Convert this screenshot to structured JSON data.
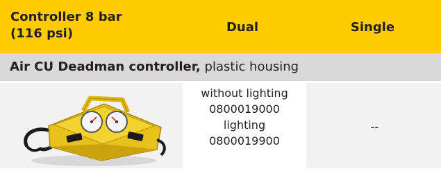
{
  "header": {
    "controller_line1": "Controller 8 bar",
    "controller_line2": "(116 psi)",
    "dual": "Dual",
    "single": "Single"
  },
  "section": {
    "name_bold": "Air CU Deadman controller,",
    "name_rest": " plastic housing"
  },
  "row": {
    "dual_lines": [
      "without lighting",
      "0800019000",
      "lighting",
      "0800019900"
    ],
    "single": "--"
  },
  "colors": {
    "header_bg": "#ffcc00",
    "section_bg": "#d9d9d9",
    "row_bg": "#f2f2f2",
    "text": "#231f20"
  }
}
